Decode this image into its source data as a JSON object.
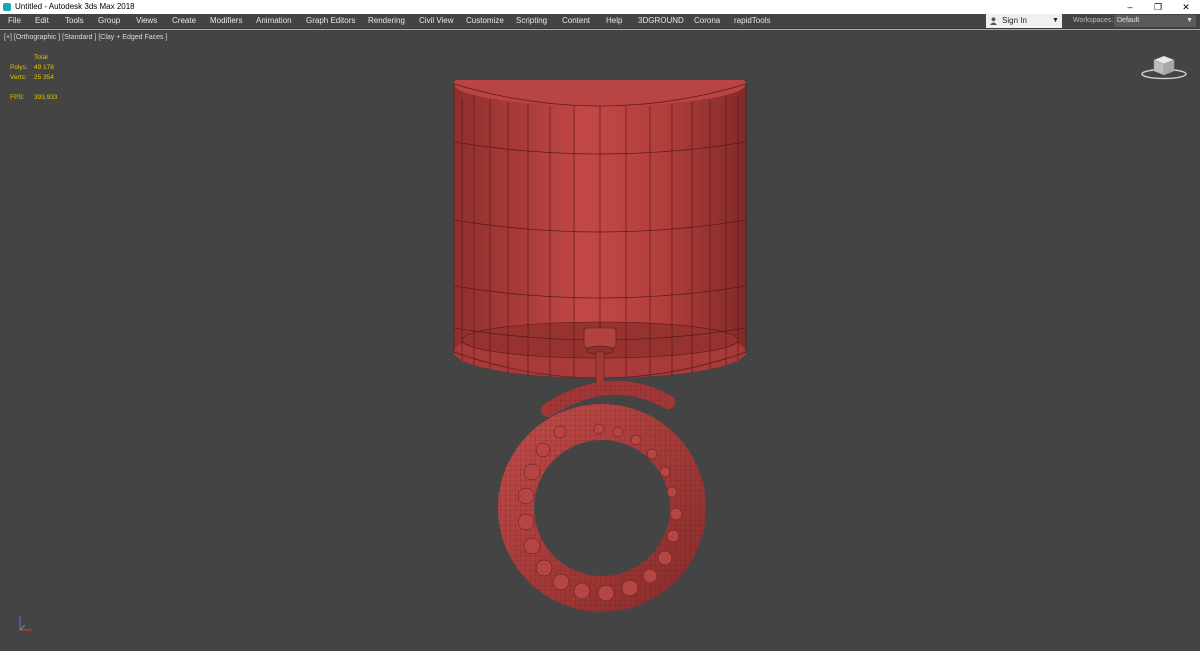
{
  "window": {
    "title": "Untitled - Autodesk 3ds Max 2018",
    "minimize": "–",
    "restore": "❐",
    "close": "✕"
  },
  "menu": [
    "File",
    "Edit",
    "Tools",
    "Group",
    "Views",
    "Create",
    "Modifiers",
    "Animation",
    "Graph Editors",
    "Rendering",
    "Civil View",
    "Customize",
    "Scripting",
    "Content",
    "Help",
    "3DGROUND",
    "Corona",
    "rapidTools"
  ],
  "signin": {
    "label": "Sign In"
  },
  "workspaces": {
    "label": "Workspaces:",
    "value": "Default"
  },
  "viewport": {
    "label": "[+] [Orthographic ] [Standard ] [Clay + Edged Faces ]",
    "stats": {
      "total_label": "Total",
      "polys_label": "Polys:",
      "polys_value": "49 178",
      "verts_label": "Verts:",
      "verts_value": "25 354",
      "fps_label": "FPS:",
      "fps_value": "393,933"
    }
  },
  "colors": {
    "accent": "#d6b200",
    "viewport_bg": "#444444",
    "model": "#b8403f",
    "stats_text": "#e6c400"
  },
  "icons": {
    "app": "3dsmax-icon",
    "user": "user-icon",
    "viewcube": "viewcube-icon",
    "axis": "axis-tripod-icon"
  }
}
